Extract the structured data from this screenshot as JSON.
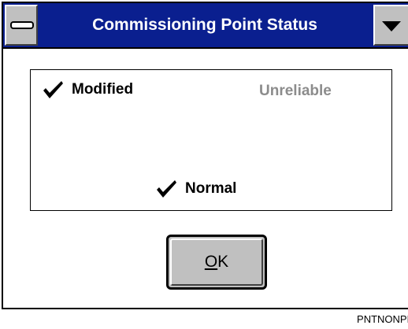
{
  "window": {
    "title": "Commissioning Point Status",
    "titlebar_color": "#0a1f8f",
    "system_menu_icon": "system-menu-bar-icon",
    "minimize_icon": "chevron-down-triangle-icon"
  },
  "status": {
    "modified": {
      "label": "Modified",
      "checked": true,
      "check_icon": "checkmark-icon"
    },
    "unreliable": {
      "label": "Unreliable",
      "checked": false,
      "color": "#8c8c8c"
    },
    "normal": {
      "label": "Normal",
      "checked": true,
      "check_icon": "checkmark-icon"
    }
  },
  "buttons": {
    "ok": {
      "mnemonic": "O",
      "rest": "K"
    }
  },
  "footer": {
    "code": "PNTNONPR"
  }
}
